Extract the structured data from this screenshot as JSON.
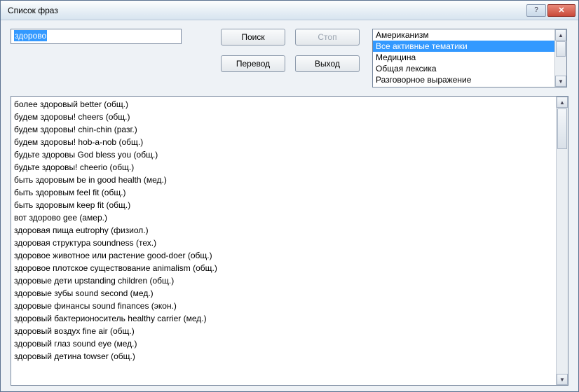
{
  "window": {
    "title": "Список фраз"
  },
  "search": {
    "value": "здорово"
  },
  "buttons": {
    "search": "Поиск",
    "stop": "Стоп",
    "translate": "Перевод",
    "exit": "Выход"
  },
  "themes": {
    "items": [
      "Американизм",
      "Все активные тематики",
      "Медицина",
      "Общая лексика",
      "Разговорное выражение"
    ],
    "selectedIndex": 1
  },
  "results": [
    "более здоровый better (общ.)",
    "будем здоровы! cheers (общ.)",
    "будем здоровы! chin-chin (разг.)",
    "будем здоровы! hob-a-nob (общ.)",
    "будьте здоровы God bless you (общ.)",
    "будьте здоровы! cheerio (общ.)",
    "быть здоровым be in good health (мед.)",
    "быть здоровым feel fit (общ.)",
    "быть здоровым keep fit (общ.)",
    "вот здорово gee (амер.)",
    "здоровая пища eutrophy (физиол.)",
    "здоровая структура soundness (тех.)",
    "здоровое животное или растение good-doer (общ.)",
    "здоровое плотское существование animalism (общ.)",
    "здоровые дети upstanding children (общ.)",
    "здоровые зубы sound second (мед.)",
    "здоровые финансы sound finances (экон.)",
    "здоровый бактерионоситель healthy carrier (мед.)",
    "здоровый воздух fine air (общ.)",
    "здоровый глаз sound eye (мед.)",
    "здоровый детина towser (общ.)"
  ]
}
